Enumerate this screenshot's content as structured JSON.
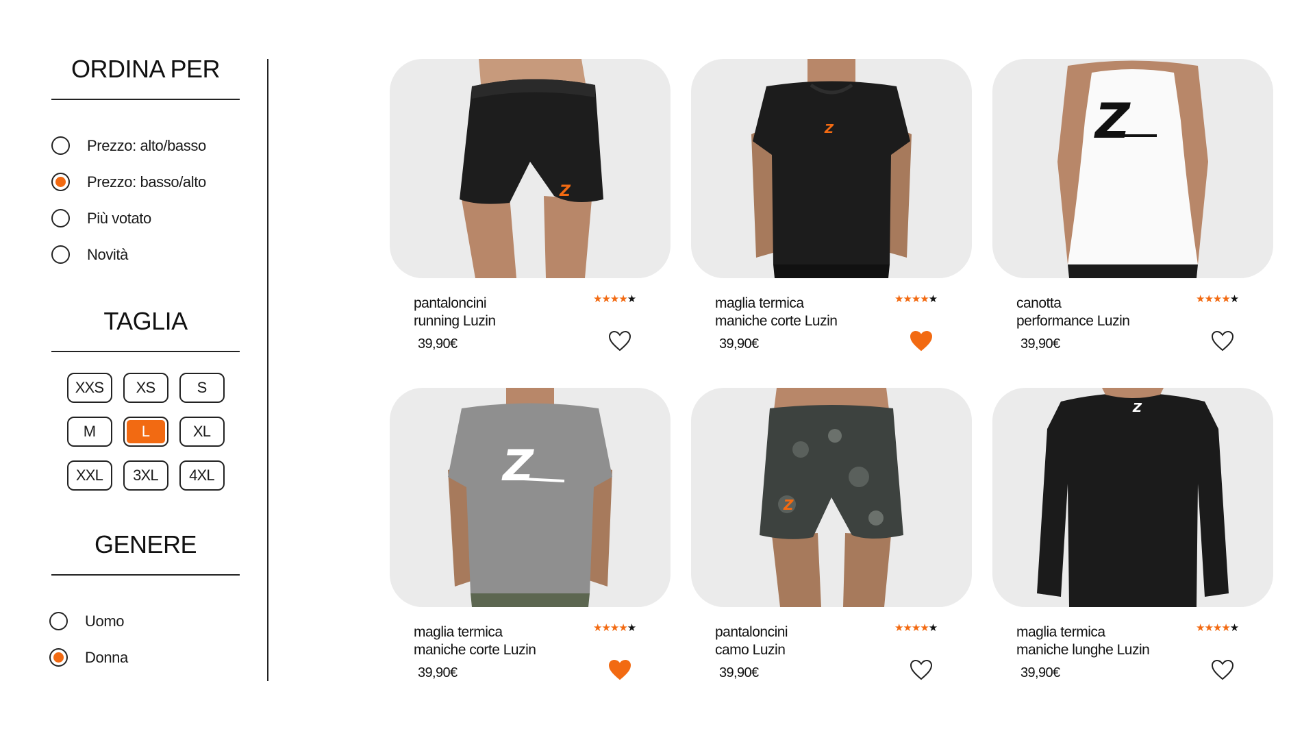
{
  "colors": {
    "accent": "#f26a12",
    "card_bg": "#ebebeb",
    "text": "#111111"
  },
  "sort": {
    "title": "ORDINA PER",
    "options": [
      {
        "label": "Prezzo: alto/basso",
        "selected": false
      },
      {
        "label": "Prezzo: basso/alto",
        "selected": true
      },
      {
        "label": "Più votato",
        "selected": false
      },
      {
        "label": "Novità",
        "selected": false
      }
    ]
  },
  "size": {
    "title": "TAGLIA",
    "options": [
      "XXS",
      "XS",
      "S",
      "M",
      "L",
      "XL",
      "XXL",
      "3XL",
      "4XL"
    ],
    "selected": "L"
  },
  "gender": {
    "title": "GENERE",
    "options": [
      {
        "label": "Uomo",
        "selected": false
      },
      {
        "label": "Donna",
        "selected": true
      }
    ]
  },
  "products": [
    {
      "name_line1": "pantaloncini",
      "name_line2": "running Luzin",
      "price": "39,90€",
      "rating": 4,
      "rating_max": 5,
      "favorite": false,
      "image": "black-shorts"
    },
    {
      "name_line1": "maglia termica",
      "name_line2": "maniche corte Luzin",
      "price": "39,90€",
      "rating": 4,
      "rating_max": 5,
      "favorite": true,
      "image": "black-tshirt"
    },
    {
      "name_line1": "canotta",
      "name_line2": "performance Luzin",
      "price": "39,90€",
      "rating": 4,
      "rating_max": 5,
      "favorite": false,
      "image": "white-tank-back"
    },
    {
      "name_line1": "maglia termica",
      "name_line2": "maniche corte Luzin",
      "price": "39,90€",
      "rating": 4,
      "rating_max": 5,
      "favorite": true,
      "image": "grey-tshirt"
    },
    {
      "name_line1": "pantaloncini",
      "name_line2": "camo Luzin",
      "price": "39,90€",
      "rating": 4,
      "rating_max": 5,
      "favorite": false,
      "image": "camo-shorts"
    },
    {
      "name_line1": "maglia termica",
      "name_line2": "maniche lunghe Luzin",
      "price": "39,90€",
      "rating": 4,
      "rating_max": 5,
      "favorite": false,
      "image": "black-longsleeve-back"
    }
  ]
}
